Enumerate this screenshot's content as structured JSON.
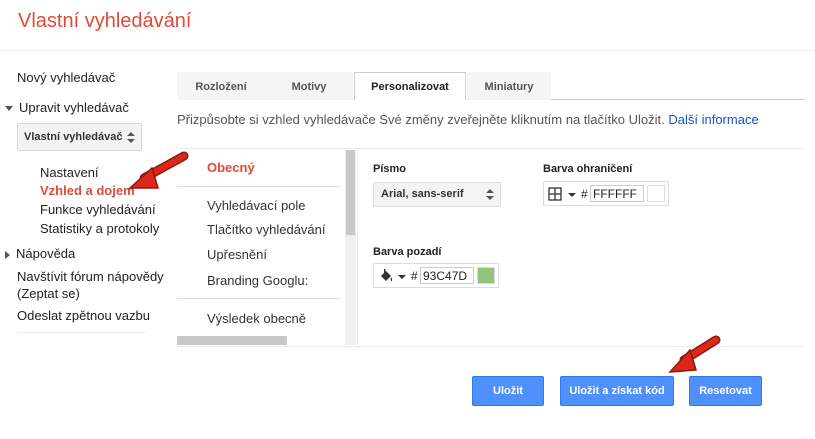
{
  "app": {
    "title": "Vlastní vyhledávání"
  },
  "sidebar": {
    "new_engine": "Nový vyhledávač",
    "edit_engine": "Upravit vyhledávač",
    "engine_select_value": "Vlastní vyhledávač",
    "sub_items": [
      "Nastavení",
      "Vzhled a dojem",
      "Funkce vyhledávání",
      "Statistiky a protokoly"
    ],
    "help": "Nápověda",
    "forum": "Navštívit fórum nápovědy",
    "forum_sub": "(Zeptat se)",
    "feedback": "Odeslat zpětnou vazbu"
  },
  "tabs": [
    "Rozložení",
    "Motivy",
    "Personalizovat",
    "Miniatury"
  ],
  "active_tab": "Personalizovat",
  "description": {
    "text": "Přizpůsobte si vzhled vyhledávače Své změny zveřejněte kliknutím na tlačítko Uložit.",
    "link": "Další informace"
  },
  "settings_list": {
    "active": "Obecný",
    "group1": [
      "Vyhledávací pole",
      "Tlačítko vyhledávání",
      "Upřesnění",
      "Branding Googlu:"
    ],
    "group2": [
      "Výsledek obecně"
    ]
  },
  "fields": {
    "font": {
      "label": "Písmo",
      "value": "Arial, sans-serif"
    },
    "border_color": {
      "label": "Barva ohraničení",
      "hash": "#",
      "value": "FFFFFF",
      "color": "#FFFFFF",
      "icon": "border-grid-icon"
    },
    "bg_color": {
      "label": "Barva pozadí",
      "hash": "#",
      "value": "93C47D",
      "color": "#93C47D",
      "icon": "paint-bucket-icon"
    }
  },
  "buttons": {
    "save": "Uložit",
    "save_get_code": "Uložit a získat kód",
    "reset": "Resetovat"
  },
  "colors": {
    "accent_red": "#dd4b39",
    "button_blue": "#4d90fe",
    "link_blue": "#1155cc"
  }
}
